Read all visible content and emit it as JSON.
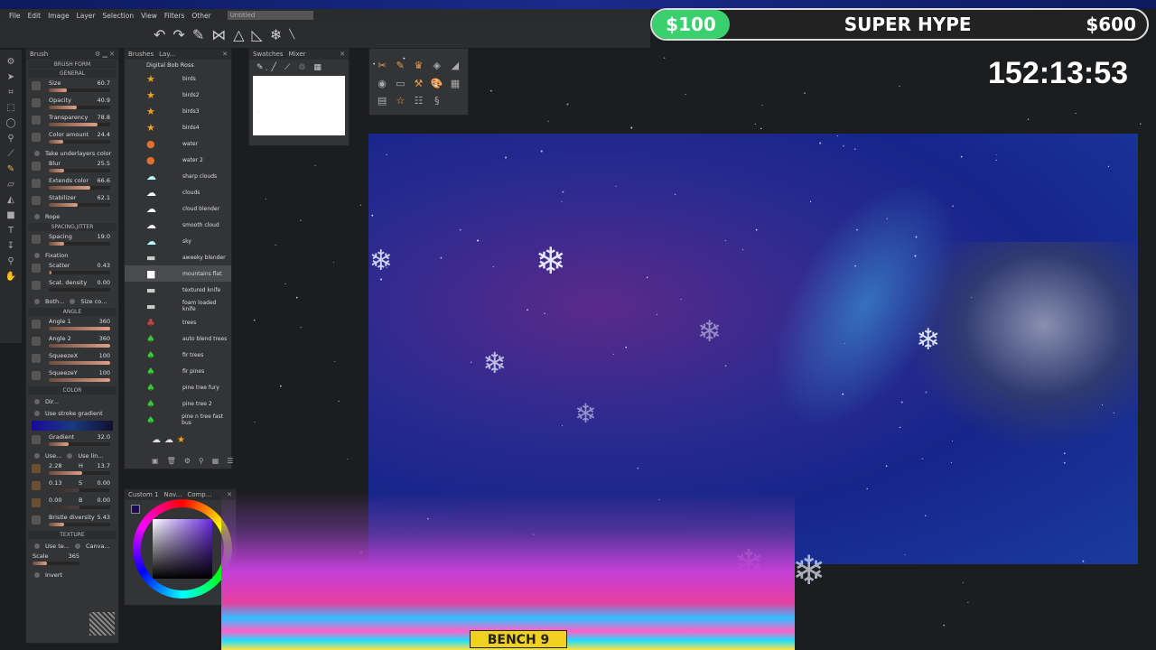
{
  "menu": [
    "File",
    "Edit",
    "Image",
    "Layer",
    "Selection",
    "View",
    "Filters",
    "Other"
  ],
  "document_title": "Untitled",
  "brush_panel": {
    "title": "Brush",
    "section_form": "BRUSH FORM",
    "section_general": "GENERAL",
    "general": [
      {
        "label": "Size",
        "value": "60.7",
        "pct": 30
      },
      {
        "label": "Opacity",
        "value": "40.9",
        "pct": 45
      },
      {
        "label": "Transparency",
        "value": "78.8",
        "pct": 79
      },
      {
        "label": "Color amount",
        "value": "24.4",
        "pct": 24
      }
    ],
    "take_underlayers": "Take underlayers color",
    "general2": [
      {
        "label": "Blur",
        "value": "25.5",
        "pct": 25
      },
      {
        "label": "Extends color",
        "value": "66.6",
        "pct": 67
      },
      {
        "label": "Stabilizer",
        "value": "62.1",
        "pct": 47
      }
    ],
    "rope": "Rope",
    "section_spacing": "SPACING,JITTER",
    "spacing": {
      "label": "Spacing",
      "value": "19.0",
      "pct": 25
    },
    "fixation": "Fixation",
    "spacing2": [
      {
        "label": "Scatter",
        "value": "0.43",
        "pct": 5
      },
      {
        "label": "Scat. density",
        "value": "0.00",
        "pct": 0
      }
    ],
    "both": "Both...",
    "size_co": "Size co...",
    "section_angle": "ANGLE",
    "angle": [
      {
        "label": "Angle 1",
        "value": "360",
        "pct": 100
      },
      {
        "label": "Angle 2",
        "value": "360",
        "pct": 100
      },
      {
        "label": "SqueezeX",
        "value": "100",
        "pct": 100
      },
      {
        "label": "SqueezeY",
        "value": "100",
        "pct": 100
      }
    ],
    "section_color": "COLOR",
    "dir": "Dir...",
    "use_stroke_gradient": "Use stroke gradient",
    "gradient": {
      "label": "Gradient",
      "value": "32.0",
      "pct": 32
    },
    "use": "Use...",
    "use_lin": "Use lin...",
    "hsb": [
      {
        "v1": "2.28",
        "ch": "H",
        "v2": "13.7",
        "pct": 55
      },
      {
        "v1": "0.13",
        "ch": "S",
        "v2": "0.00",
        "pct": 50
      },
      {
        "v1": "0.00",
        "ch": "B",
        "v2": "0.00",
        "pct": 50
      }
    ],
    "bristle": {
      "label": "Bristle diversity",
      "value": "5.43",
      "pct": 25
    },
    "section_texture": "TEXTURE",
    "use_te": "Use te...",
    "canva": "Canva...",
    "scale_label": "Scale",
    "scale_value": "365",
    "invert": "Invert"
  },
  "brushes_panel": {
    "tabs": [
      "Brushes",
      "Lay..."
    ],
    "set": "Digital Bob Ross",
    "items": [
      "birds",
      "birds2",
      "birds3",
      "birds4",
      "water",
      "water 2",
      "sharp clouds",
      "clouds",
      "cloud blender",
      "smooth cloud",
      "sky",
      "aweeky blender",
      "mountains flat",
      "textured knife",
      "foam loaded knife",
      "trees",
      "auto blend trees",
      "fir trees",
      "fir pines",
      "pine tree fury",
      "pine tree 2",
      "pine n tree fast bus"
    ]
  },
  "mixer_panel": {
    "tabs": [
      "Swatches",
      "Mixer"
    ]
  },
  "color_panel": {
    "tabs": [
      "Custom 1",
      "Nav...",
      "Comp..."
    ]
  },
  "hype_train": {
    "low": "$100",
    "label": "SUPER HYPE",
    "high": "$600",
    "progress": 0.15
  },
  "timer": "152:13:53",
  "overlay_label": "BENCH 9"
}
